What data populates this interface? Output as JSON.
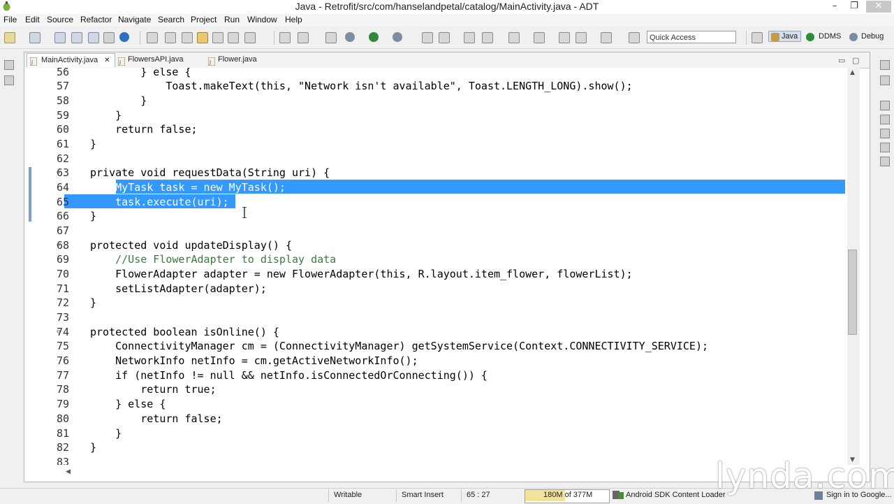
{
  "window": {
    "title": "Java - Retrofit/src/com/hanselandpetal/catalog/MainActivity.java - ADT",
    "minimize": "–",
    "maximize": "❐",
    "close": "✕"
  },
  "menu": [
    "File",
    "Edit",
    "Source",
    "Refactor",
    "Navigate",
    "Search",
    "Project",
    "Run",
    "Window",
    "Help"
  ],
  "toolbar": {
    "quick_access_placeholder": "Quick Access",
    "perspectives": [
      "Java",
      "DDMS",
      "Debug"
    ]
  },
  "tabs": [
    {
      "label": "MainActivity.java",
      "active": true,
      "close": "✕"
    },
    {
      "label": "FlowersAPI.java",
      "active": false
    },
    {
      "label": "Flower.java",
      "active": false
    }
  ],
  "code_lines": [
    {
      "num": "56",
      "text": "        } else {"
    },
    {
      "num": "57",
      "text": "            Toast.makeText(this, \"Network isn't available\", Toast.LENGTH_LONG).show();"
    },
    {
      "num": "58",
      "text": "        }"
    },
    {
      "num": "59",
      "text": "    }"
    },
    {
      "num": "60",
      "text": "    return false;"
    },
    {
      "num": "61",
      "text": "}"
    },
    {
      "num": "62",
      "text": ""
    },
    {
      "num": "63",
      "text": "private void requestData(String uri) {"
    },
    {
      "num": "64",
      "text": "    MyTask task = new MyTask();"
    },
    {
      "num": "65",
      "text": "    task.execute(uri);"
    },
    {
      "num": "66",
      "text": "}"
    },
    {
      "num": "67",
      "text": ""
    },
    {
      "num": "68",
      "text": "protected void updateDisplay() {"
    },
    {
      "num": "69",
      "text": "    //Use FlowerAdapter to display data"
    },
    {
      "num": "70",
      "text": "    FlowerAdapter adapter = new FlowerAdapter(this, R.layout.item_flower, flowerList);"
    },
    {
      "num": "71",
      "text": "    setListAdapter(adapter);"
    },
    {
      "num": "72",
      "text": "}"
    },
    {
      "num": "73",
      "text": ""
    },
    {
      "num": "74",
      "text": "protected boolean isOnline() {"
    },
    {
      "num": "75",
      "text": "    ConnectivityManager cm = (ConnectivityManager) getSystemService(Context.CONNECTIVITY_SERVICE);"
    },
    {
      "num": "76",
      "text": "    NetworkInfo netInfo = cm.getActiveNetworkInfo();"
    },
    {
      "num": "77",
      "text": "    if (netInfo != null && netInfo.isConnectedOrConnecting()) {"
    },
    {
      "num": "78",
      "text": "        return true;"
    },
    {
      "num": "79",
      "text": "    } else {"
    },
    {
      "num": "80",
      "text": "        return false;"
    },
    {
      "num": "81",
      "text": "    }"
    },
    {
      "num": "82",
      "text": "}"
    },
    {
      "num": "83",
      "text": ""
    }
  ],
  "statusbar": {
    "writable": "Writable",
    "insert_mode": "Smart Insert",
    "position": "65 : 27",
    "heap": "180M of 377M",
    "heap_used_fraction": 0.48,
    "loader": "Android SDK Content Loader",
    "signin": "Sign in to Google..."
  },
  "watermark": "lynda.com"
}
